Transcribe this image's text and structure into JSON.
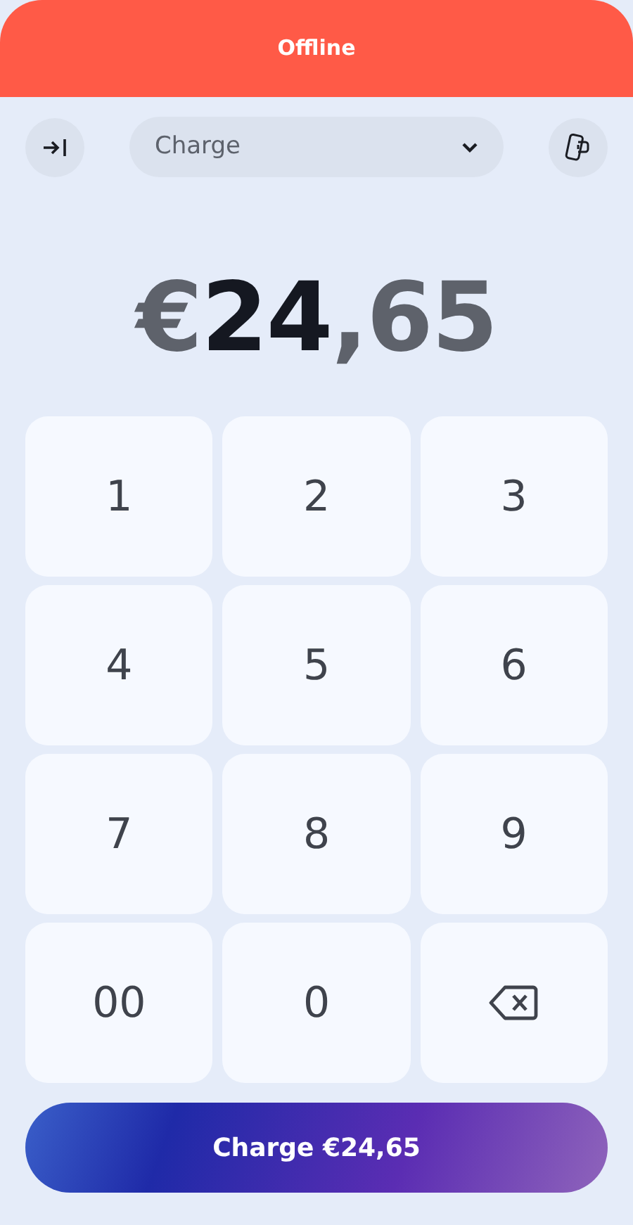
{
  "status_banner": {
    "text": "Offline"
  },
  "toolbar": {
    "mode_select": {
      "value": "Charge"
    }
  },
  "amount": {
    "currency": "€",
    "whole": "24",
    "decimals": ",65"
  },
  "keypad": [
    {
      "kind": "digit",
      "label": "1"
    },
    {
      "kind": "digit",
      "label": "2"
    },
    {
      "kind": "digit",
      "label": "3"
    },
    {
      "kind": "digit",
      "label": "4"
    },
    {
      "kind": "digit",
      "label": "5"
    },
    {
      "kind": "digit",
      "label": "6"
    },
    {
      "kind": "digit",
      "label": "7"
    },
    {
      "kind": "digit",
      "label": "8"
    },
    {
      "kind": "digit",
      "label": "9"
    },
    {
      "kind": "digit",
      "label": "00"
    },
    {
      "kind": "digit",
      "label": "0"
    },
    {
      "kind": "backspace"
    }
  ],
  "charge_button": {
    "label": "Charge €24,65"
  }
}
